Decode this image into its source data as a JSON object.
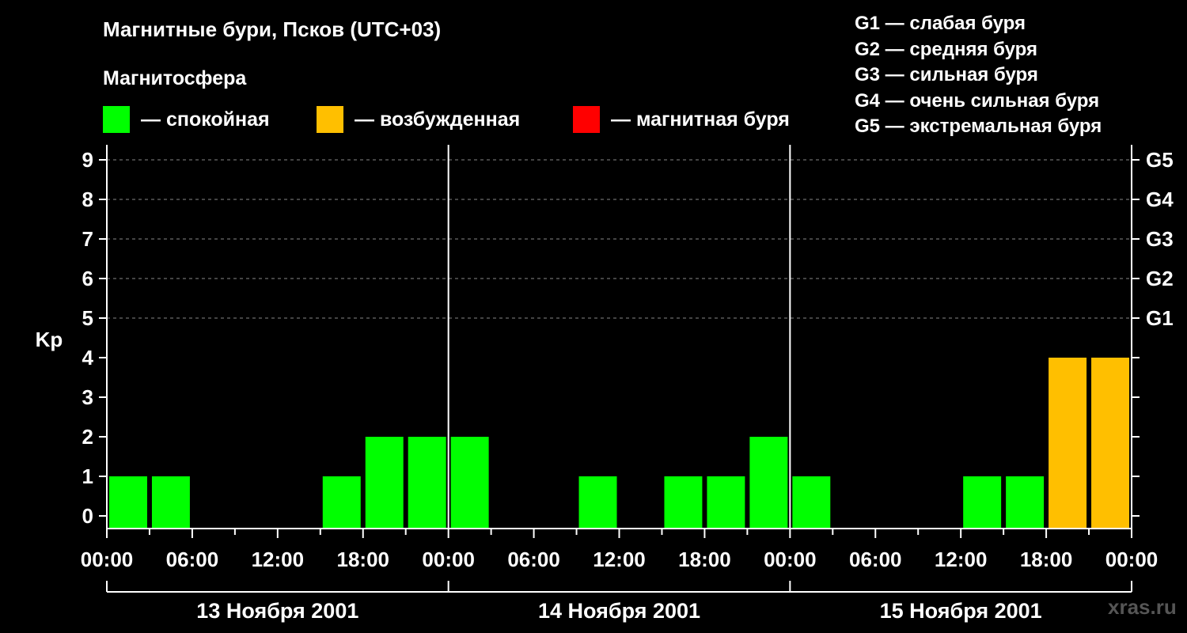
{
  "header": {
    "title": "Магнитные бури, Псков (UTC+03)",
    "subtitle": "Магнитосфера"
  },
  "legend": [
    {
      "label": "— спокойная",
      "color": "#00ff00"
    },
    {
      "label": "— возбужденная",
      "color": "#ffbf00"
    },
    {
      "label": "— магнитная буря",
      "color": "#ff0000"
    }
  ],
  "storm_levels": [
    "G1 — слабая буря",
    "G2 — средняя буря",
    "G3 — сильная буря",
    "G4 — очень сильная буря",
    "G5 — экстремальная буря"
  ],
  "watermark": "xras.ru",
  "chart_data": {
    "type": "bar",
    "ylabel": "Kp",
    "ylim": [
      0,
      9
    ],
    "y_ticks": [
      "0",
      "1",
      "2",
      "3",
      "4",
      "5",
      "6",
      "7",
      "8",
      "9"
    ],
    "right_ticks": [
      {
        "value": 5,
        "label": "G1"
      },
      {
        "value": 6,
        "label": "G2"
      },
      {
        "value": 7,
        "label": "G3"
      },
      {
        "value": 8,
        "label": "G4"
      },
      {
        "value": 9,
        "label": "G5"
      }
    ],
    "x_tick_labels": [
      "00:00",
      "06:00",
      "12:00",
      "18:00",
      "00:00",
      "06:00",
      "12:00",
      "18:00",
      "00:00",
      "06:00",
      "12:00",
      "18:00",
      "00:00"
    ],
    "days": [
      "13 Ноября 2001",
      "14 Ноября 2001",
      "15 Ноября 2001"
    ],
    "interval_hours": 3,
    "values": [
      1,
      1,
      0,
      0,
      0,
      1,
      2,
      2,
      2,
      0,
      0,
      1,
      0,
      1,
      1,
      2,
      1,
      0,
      0,
      0,
      1,
      1,
      4,
      4
    ],
    "colors": {
      "quiet": "#00ff00",
      "active": "#ffbf00",
      "storm": "#ff0000"
    },
    "grid": true
  }
}
